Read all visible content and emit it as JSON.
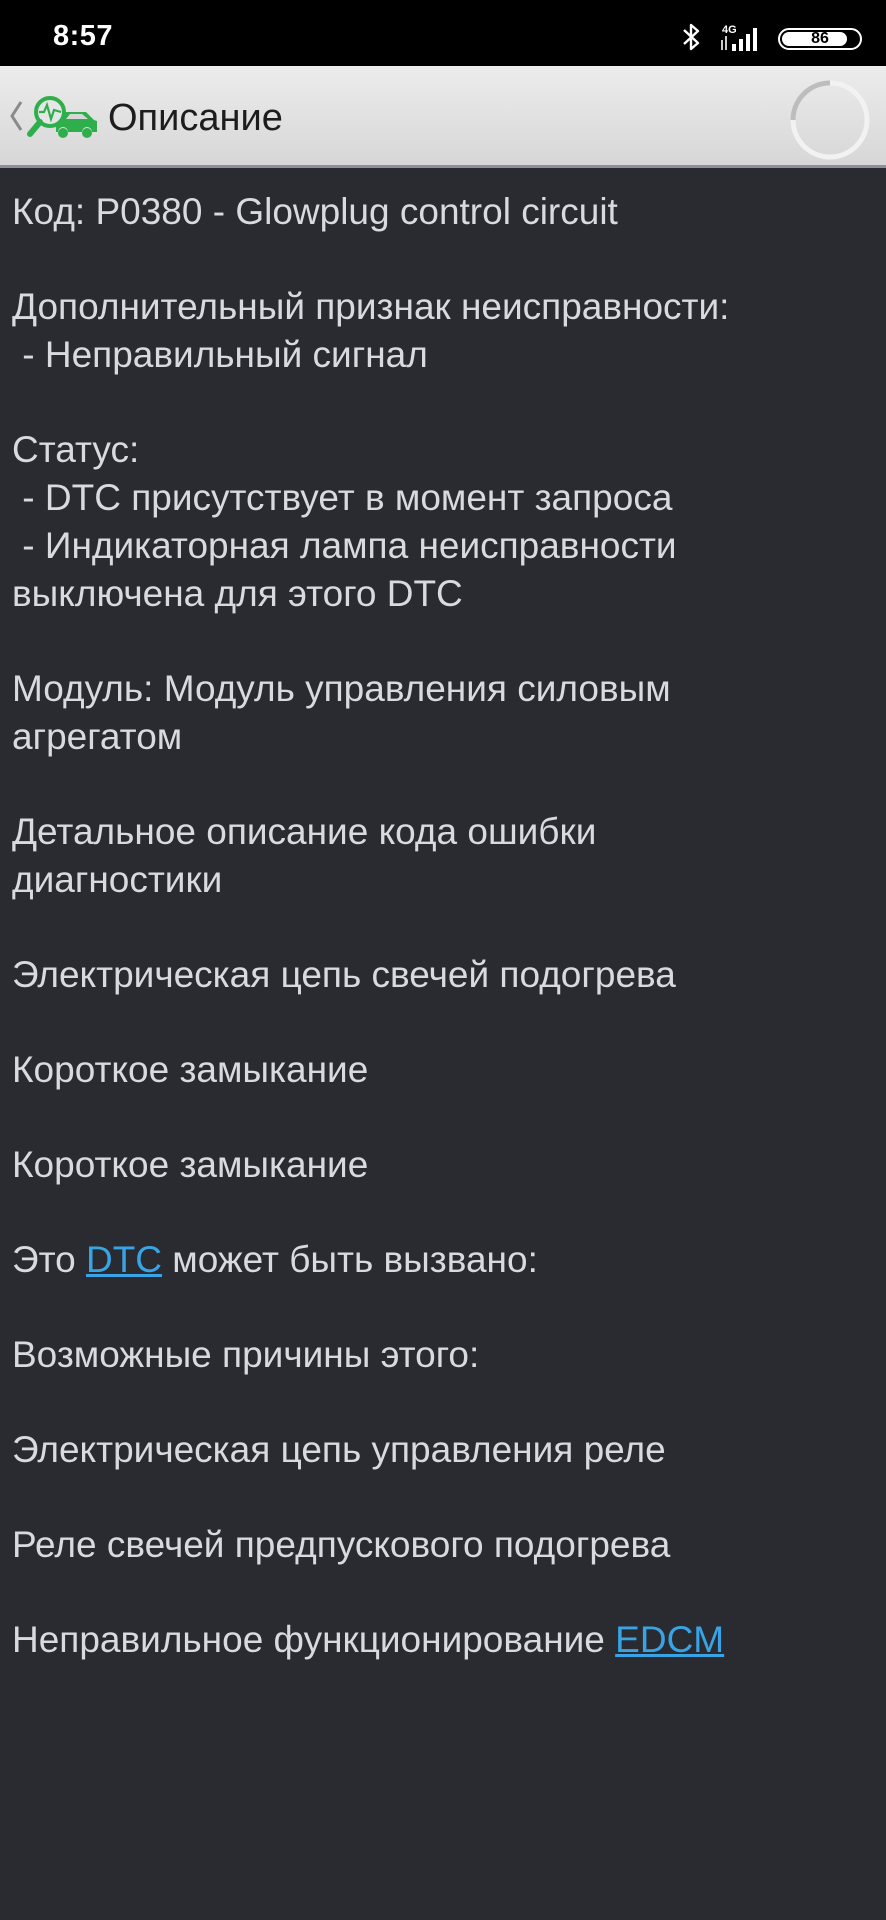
{
  "status_bar": {
    "time": "8:57",
    "network": "4G",
    "battery": "86",
    "battery_level": 0.86,
    "icons": [
      "bluetooth-icon",
      "signal-icon",
      "battery-icon"
    ]
  },
  "app_bar": {
    "title": "Описание",
    "icons": [
      "back-chevron-icon",
      "car-diagnostic-logo-icon",
      "loading-spinner-icon"
    ]
  },
  "description": {
    "code": "Код: P0380 - Glowplug control circuit",
    "extra_symptom_label": "Дополнительный признак неисправности:",
    "extra_symptom_item": " - Неправильный сигнал",
    "status_label": "Статус:",
    "status_item_1": " - DTC присутствует в момент запроса",
    "status_item_2a": " - Индикаторная лампа неисправности",
    "status_item_2b": "выключена для этого DTC",
    "module_a": "Модуль: Модуль управления силовым",
    "module_b": "агрегатом",
    "detail_a": "Детальное описание кода ошибки",
    "detail_b": "диагностики",
    "circuit": "Электрическая цепь свечей подогрева",
    "short_1": "Короткое замыкание",
    "short_2": "Короткое замыкание",
    "cause_prefix": "Это ",
    "cause_link": "DTC",
    "cause_suffix": " может быть вызвано:",
    "possible_reasons": "Возможные причины этого:",
    "reason_1": "Электрическая цепь управления реле",
    "reason_2": "Реле свечей предпускового подогрева",
    "reason_3_prefix": "Неправильное функционирование ",
    "reason_3_link": "EDCM"
  },
  "colors": {
    "background": "#2a2b31",
    "text": "#d9dadf",
    "link": "#38a4e6",
    "app_bar": "#e2e2e2",
    "logo_green": "#2fae4c"
  }
}
